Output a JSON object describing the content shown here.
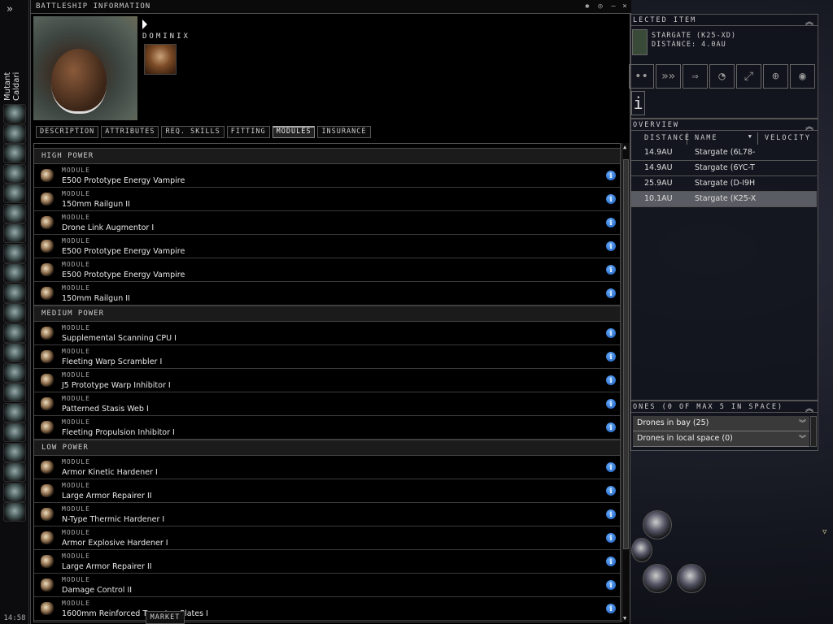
{
  "sidebar": {
    "character": "Mutant Caldari",
    "clock": "14:58",
    "expand_icon": "double-chevron-right"
  },
  "window": {
    "title": "BATTLESHIP INFORMATION",
    "ship_name": "DOMINIX",
    "tabs": [
      {
        "label": "DESCRIPTION"
      },
      {
        "label": "ATTRIBUTES"
      },
      {
        "label": "REQ. SKILLS"
      },
      {
        "label": "FITTING"
      },
      {
        "label": "MODULES",
        "active": true
      },
      {
        "label": "INSURANCE"
      }
    ],
    "sections": [
      {
        "title": "HIGH POWER",
        "items": [
          {
            "type": "MODULE",
            "name": "E500 Prototype Energy Vampire"
          },
          {
            "type": "MODULE",
            "name": "150mm Railgun II"
          },
          {
            "type": "MODULE",
            "name": "Drone Link Augmentor I"
          },
          {
            "type": "MODULE",
            "name": "E500 Prototype Energy Vampire"
          },
          {
            "type": "MODULE",
            "name": "E500 Prototype Energy Vampire"
          },
          {
            "type": "MODULE",
            "name": "150mm Railgun II"
          }
        ]
      },
      {
        "title": "MEDIUM POWER",
        "items": [
          {
            "type": "MODULE",
            "name": "Supplemental Scanning CPU I"
          },
          {
            "type": "MODULE",
            "name": "Fleeting Warp Scrambler I"
          },
          {
            "type": "MODULE",
            "name": "J5 Prototype Warp Inhibitor I"
          },
          {
            "type": "MODULE",
            "name": "Patterned Stasis Web I"
          },
          {
            "type": "MODULE",
            "name": "Fleeting Propulsion Inhibitor I"
          }
        ]
      },
      {
        "title": "LOW POWER",
        "items": [
          {
            "type": "MODULE",
            "name": "Armor Kinetic Hardener I"
          },
          {
            "type": "MODULE",
            "name": "Large Armor Repairer II"
          },
          {
            "type": "MODULE",
            "name": "N-Type Thermic Hardener I"
          },
          {
            "type": "MODULE",
            "name": "Armor Explosive Hardener I"
          },
          {
            "type": "MODULE",
            "name": "Large Armor Repairer II"
          },
          {
            "type": "MODULE",
            "name": "Damage Control II"
          },
          {
            "type": "MODULE",
            "name": "1600mm Reinforced Tungsten Plates I"
          }
        ]
      }
    ],
    "info_glyph": "i",
    "tooltip": "MARKET"
  },
  "selected_item": {
    "title": "LECTED ITEM",
    "name": "STARGATE (K25-XD)",
    "distance": "DISTANCE: 4.0AU",
    "actions": [
      "approach-icon",
      "warp-icon",
      "jump-icon",
      "orbit-icon",
      "keep-range-icon",
      "target-icon",
      "look-at-icon",
      "info-icon"
    ]
  },
  "overview": {
    "title": "OVERVIEW",
    "columns": [
      "DISTANCE",
      "NAME",
      "VELOCITY"
    ],
    "rows": [
      {
        "distance": "14.9AU",
        "name": "Stargate (6L78-"
      },
      {
        "distance": "14.9AU",
        "name": "Stargate (6YC-T"
      },
      {
        "distance": "25.9AU",
        "name": "Stargate (D-I9H"
      },
      {
        "distance": "10.1AU",
        "name": "Stargate (K25-X",
        "selected": true
      }
    ]
  },
  "drones": {
    "title": "ONES (0 OF MAX 5 IN SPACE)",
    "groups": [
      "Drones in bay (25)",
      "Drones in local space (0)"
    ]
  },
  "colors": {
    "info": "#1f6fd6",
    "selected_row": "#5a5c63"
  }
}
